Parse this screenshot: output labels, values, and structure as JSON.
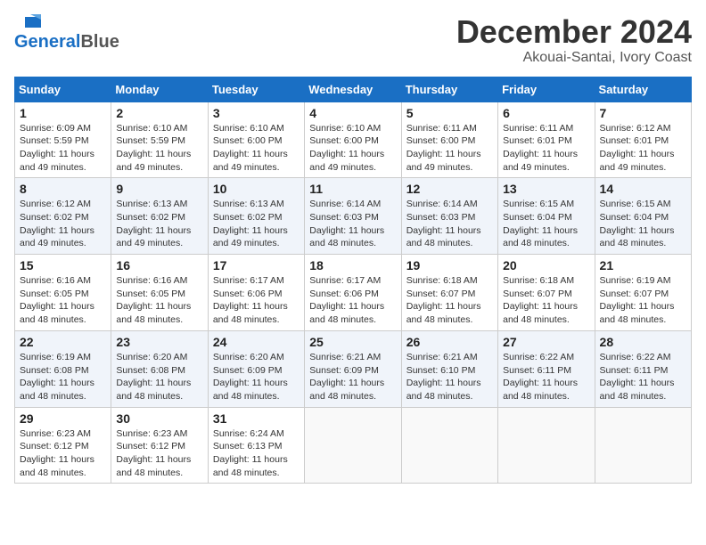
{
  "header": {
    "logo_line1": "General",
    "logo_line2": "Blue",
    "title": "December 2024",
    "subtitle": "Akouai-Santai, Ivory Coast"
  },
  "weekdays": [
    "Sunday",
    "Monday",
    "Tuesday",
    "Wednesday",
    "Thursday",
    "Friday",
    "Saturday"
  ],
  "weeks": [
    [
      {
        "day": "1",
        "info": "Sunrise: 6:09 AM\nSunset: 5:59 PM\nDaylight: 11 hours and 49 minutes."
      },
      {
        "day": "2",
        "info": "Sunrise: 6:10 AM\nSunset: 5:59 PM\nDaylight: 11 hours and 49 minutes."
      },
      {
        "day": "3",
        "info": "Sunrise: 6:10 AM\nSunset: 6:00 PM\nDaylight: 11 hours and 49 minutes."
      },
      {
        "day": "4",
        "info": "Sunrise: 6:10 AM\nSunset: 6:00 PM\nDaylight: 11 hours and 49 minutes."
      },
      {
        "day": "5",
        "info": "Sunrise: 6:11 AM\nSunset: 6:00 PM\nDaylight: 11 hours and 49 minutes."
      },
      {
        "day": "6",
        "info": "Sunrise: 6:11 AM\nSunset: 6:01 PM\nDaylight: 11 hours and 49 minutes."
      },
      {
        "day": "7",
        "info": "Sunrise: 6:12 AM\nSunset: 6:01 PM\nDaylight: 11 hours and 49 minutes."
      }
    ],
    [
      {
        "day": "8",
        "info": "Sunrise: 6:12 AM\nSunset: 6:02 PM\nDaylight: 11 hours and 49 minutes."
      },
      {
        "day": "9",
        "info": "Sunrise: 6:13 AM\nSunset: 6:02 PM\nDaylight: 11 hours and 49 minutes."
      },
      {
        "day": "10",
        "info": "Sunrise: 6:13 AM\nSunset: 6:02 PM\nDaylight: 11 hours and 49 minutes."
      },
      {
        "day": "11",
        "info": "Sunrise: 6:14 AM\nSunset: 6:03 PM\nDaylight: 11 hours and 48 minutes."
      },
      {
        "day": "12",
        "info": "Sunrise: 6:14 AM\nSunset: 6:03 PM\nDaylight: 11 hours and 48 minutes."
      },
      {
        "day": "13",
        "info": "Sunrise: 6:15 AM\nSunset: 6:04 PM\nDaylight: 11 hours and 48 minutes."
      },
      {
        "day": "14",
        "info": "Sunrise: 6:15 AM\nSunset: 6:04 PM\nDaylight: 11 hours and 48 minutes."
      }
    ],
    [
      {
        "day": "15",
        "info": "Sunrise: 6:16 AM\nSunset: 6:05 PM\nDaylight: 11 hours and 48 minutes."
      },
      {
        "day": "16",
        "info": "Sunrise: 6:16 AM\nSunset: 6:05 PM\nDaylight: 11 hours and 48 minutes."
      },
      {
        "day": "17",
        "info": "Sunrise: 6:17 AM\nSunset: 6:06 PM\nDaylight: 11 hours and 48 minutes."
      },
      {
        "day": "18",
        "info": "Sunrise: 6:17 AM\nSunset: 6:06 PM\nDaylight: 11 hours and 48 minutes."
      },
      {
        "day": "19",
        "info": "Sunrise: 6:18 AM\nSunset: 6:07 PM\nDaylight: 11 hours and 48 minutes."
      },
      {
        "day": "20",
        "info": "Sunrise: 6:18 AM\nSunset: 6:07 PM\nDaylight: 11 hours and 48 minutes."
      },
      {
        "day": "21",
        "info": "Sunrise: 6:19 AM\nSunset: 6:07 PM\nDaylight: 11 hours and 48 minutes."
      }
    ],
    [
      {
        "day": "22",
        "info": "Sunrise: 6:19 AM\nSunset: 6:08 PM\nDaylight: 11 hours and 48 minutes."
      },
      {
        "day": "23",
        "info": "Sunrise: 6:20 AM\nSunset: 6:08 PM\nDaylight: 11 hours and 48 minutes."
      },
      {
        "day": "24",
        "info": "Sunrise: 6:20 AM\nSunset: 6:09 PM\nDaylight: 11 hours and 48 minutes."
      },
      {
        "day": "25",
        "info": "Sunrise: 6:21 AM\nSunset: 6:09 PM\nDaylight: 11 hours and 48 minutes."
      },
      {
        "day": "26",
        "info": "Sunrise: 6:21 AM\nSunset: 6:10 PM\nDaylight: 11 hours and 48 minutes."
      },
      {
        "day": "27",
        "info": "Sunrise: 6:22 AM\nSunset: 6:11 PM\nDaylight: 11 hours and 48 minutes."
      },
      {
        "day": "28",
        "info": "Sunrise: 6:22 AM\nSunset: 6:11 PM\nDaylight: 11 hours and 48 minutes."
      }
    ],
    [
      {
        "day": "29",
        "info": "Sunrise: 6:23 AM\nSunset: 6:12 PM\nDaylight: 11 hours and 48 minutes."
      },
      {
        "day": "30",
        "info": "Sunrise: 6:23 AM\nSunset: 6:12 PM\nDaylight: 11 hours and 48 minutes."
      },
      {
        "day": "31",
        "info": "Sunrise: 6:24 AM\nSunset: 6:13 PM\nDaylight: 11 hours and 48 minutes."
      },
      null,
      null,
      null,
      null
    ]
  ]
}
